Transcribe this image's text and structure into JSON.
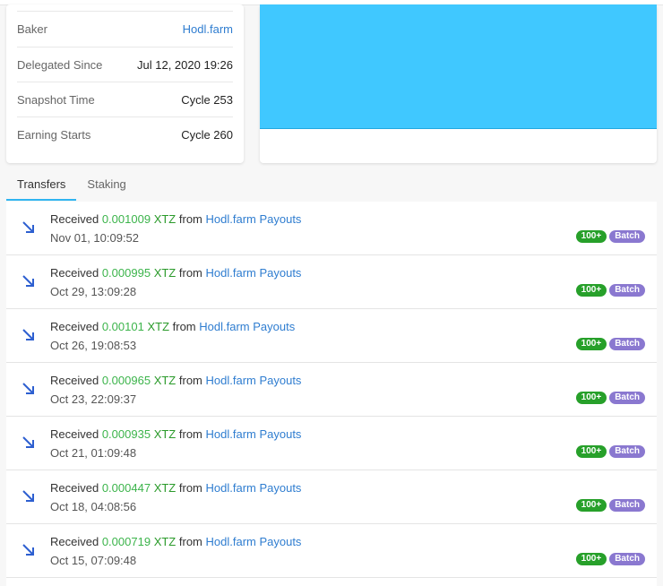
{
  "info": [
    {
      "label": "Baker",
      "value": "Hodl.farm",
      "link": true
    },
    {
      "label": "Delegated Since",
      "value": "Jul 12, 2020 19:26"
    },
    {
      "label": "Snapshot Time",
      "value": "Cycle 253"
    },
    {
      "label": "Earning Starts",
      "value": "Cycle 260"
    }
  ],
  "tabs": [
    "Transfers",
    "Staking"
  ],
  "transfers": [
    {
      "verb": "Received",
      "amount": "0.001009",
      "unit": "XTZ",
      "from": "from",
      "source": "Hodl.farm Payouts",
      "time": "Nov 01, 10:09:52",
      "badge1": "100+",
      "badge2": "Batch"
    },
    {
      "verb": "Received",
      "amount": "0.000995",
      "unit": "XTZ",
      "from": "from",
      "source": "Hodl.farm Payouts",
      "time": "Oct 29, 13:09:28",
      "badge1": "100+",
      "badge2": "Batch"
    },
    {
      "verb": "Received",
      "amount": "0.00101",
      "unit": "XTZ",
      "from": "from",
      "source": "Hodl.farm Payouts",
      "time": "Oct 26, 19:08:53",
      "badge1": "100+",
      "badge2": "Batch"
    },
    {
      "verb": "Received",
      "amount": "0.000965",
      "unit": "XTZ",
      "from": "from",
      "source": "Hodl.farm Payouts",
      "time": "Oct 23, 22:09:37",
      "badge1": "100+",
      "badge2": "Batch"
    },
    {
      "verb": "Received",
      "amount": "0.000935",
      "unit": "XTZ",
      "from": "from",
      "source": "Hodl.farm Payouts",
      "time": "Oct 21, 01:09:48",
      "badge1": "100+",
      "badge2": "Batch"
    },
    {
      "verb": "Received",
      "amount": "0.000447",
      "unit": "XTZ",
      "from": "from",
      "source": "Hodl.farm Payouts",
      "time": "Oct 18, 04:08:56",
      "badge1": "100+",
      "badge2": "Batch"
    },
    {
      "verb": "Received",
      "amount": "0.000719",
      "unit": "XTZ",
      "from": "from",
      "source": "Hodl.farm Payouts",
      "time": "Oct 15, 07:09:48",
      "badge1": "100+",
      "badge2": "Batch"
    }
  ]
}
